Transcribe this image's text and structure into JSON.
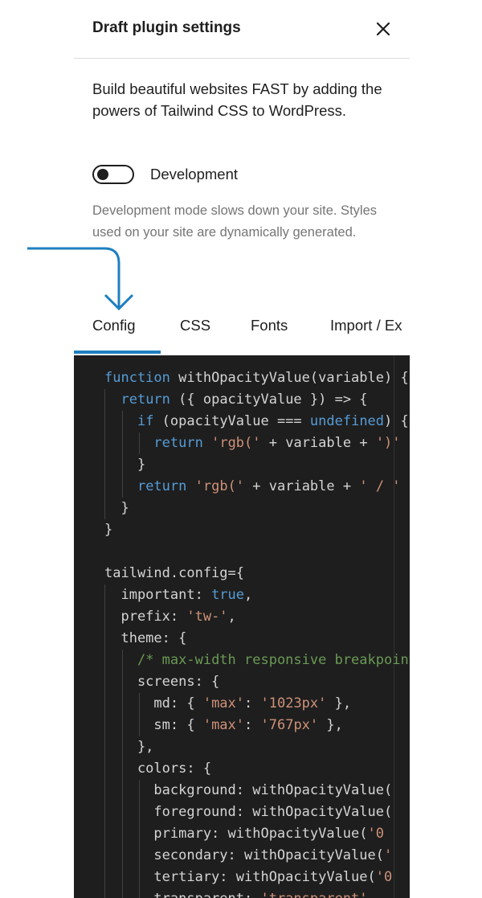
{
  "header": {
    "title": "Draft plugin settings",
    "close_icon": "close-icon"
  },
  "description": "Build beautiful websites FAST by adding the powers of Tailwind CSS to WordPress.",
  "development": {
    "label": "Development",
    "enabled": false
  },
  "help_text": "Development mode slows down your site. Styles used on your site are dynamically generated.",
  "tabs": [
    {
      "label": "Config",
      "active": true
    },
    {
      "label": "CSS",
      "active": false
    },
    {
      "label": "Fonts",
      "active": false
    },
    {
      "label": "Import / Ex",
      "active": false
    }
  ],
  "colors": {
    "accent": "#1e7fc0",
    "code_bg": "#1e1e1e",
    "keyword": "#569cd6",
    "string": "#ce9178",
    "comment": "#6a9955",
    "plain": "#d4d4d4"
  },
  "code_lines": [
    [
      [
        "kw",
        "function"
      ],
      [
        "p",
        " withOpacityValue(variable) {"
      ]
    ],
    [
      [
        "p",
        "  "
      ],
      [
        "kw",
        "return"
      ],
      [
        "p",
        " ({ opacityValue }) => {"
      ]
    ],
    [
      [
        "p",
        "    "
      ],
      [
        "kw",
        "if"
      ],
      [
        "p",
        " (opacityValue === "
      ],
      [
        "kw",
        "undefined"
      ],
      [
        "p",
        ") {"
      ]
    ],
    [
      [
        "p",
        "      "
      ],
      [
        "kw",
        "return"
      ],
      [
        "p",
        " "
      ],
      [
        "str",
        "'rgb('"
      ],
      [
        "p",
        " + variable + "
      ],
      [
        "str",
        "')'"
      ]
    ],
    [
      [
        "p",
        "    }"
      ]
    ],
    [
      [
        "p",
        "    "
      ],
      [
        "kw",
        "return"
      ],
      [
        "p",
        " "
      ],
      [
        "str",
        "'rgb('"
      ],
      [
        "p",
        " + variable + "
      ],
      [
        "str",
        "' / '"
      ]
    ],
    [
      [
        "p",
        "  }"
      ]
    ],
    [
      [
        "p",
        "}"
      ]
    ],
    [
      [
        "p",
        ""
      ]
    ],
    [
      [
        "p",
        "tailwind.config={"
      ]
    ],
    [
      [
        "p",
        "  important: "
      ],
      [
        "kw",
        "true"
      ],
      [
        "p",
        ","
      ]
    ],
    [
      [
        "p",
        "  prefix: "
      ],
      [
        "str",
        "'tw-'"
      ],
      [
        "p",
        ","
      ]
    ],
    [
      [
        "p",
        "  theme: {"
      ]
    ],
    [
      [
        "p",
        "    "
      ],
      [
        "cm",
        "/* max-width responsive breakpoints */"
      ]
    ],
    [
      [
        "p",
        "    screens: {"
      ]
    ],
    [
      [
        "p",
        "      md: { "
      ],
      [
        "str",
        "'max'"
      ],
      [
        "p",
        ": "
      ],
      [
        "str",
        "'1023px'"
      ],
      [
        "p",
        " },"
      ]
    ],
    [
      [
        "p",
        "      sm: { "
      ],
      [
        "str",
        "'max'"
      ],
      [
        "p",
        ": "
      ],
      [
        "str",
        "'767px'"
      ],
      [
        "p",
        " },"
      ]
    ],
    [
      [
        "p",
        "    },"
      ]
    ],
    [
      [
        "p",
        "    colors: {"
      ]
    ],
    [
      [
        "p",
        "      background: withOpacityValue("
      ]
    ],
    [
      [
        "p",
        "      foreground: withOpacityValue("
      ]
    ],
    [
      [
        "p",
        "      primary: withOpacityValue("
      ],
      [
        "str",
        "'0"
      ]
    ],
    [
      [
        "p",
        "      secondary: withOpacityValue("
      ],
      [
        "str",
        "'"
      ]
    ],
    [
      [
        "p",
        "      tertiary: withOpacityValue("
      ],
      [
        "str",
        "'0"
      ]
    ],
    [
      [
        "p",
        "      transparent: "
      ],
      [
        "str",
        "'transparent',"
      ]
    ]
  ]
}
